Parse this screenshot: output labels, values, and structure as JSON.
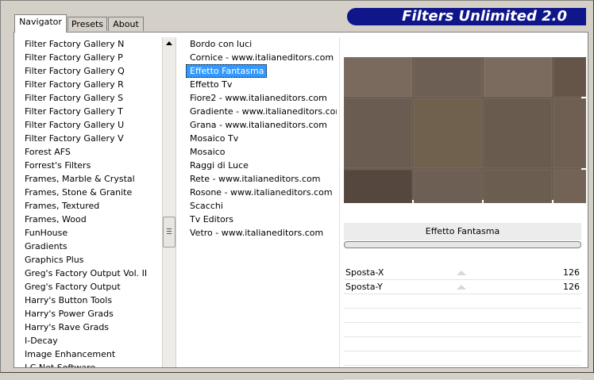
{
  "app": {
    "banner_title": "Filters Unlimited 2.0"
  },
  "tabs": [
    {
      "label": "Navigator",
      "active": true
    },
    {
      "label": "Presets",
      "active": false
    },
    {
      "label": "About",
      "active": false
    }
  ],
  "categories": [
    "Filter Factory Gallery N",
    "Filter Factory Gallery P",
    "Filter Factory Gallery Q",
    "Filter Factory Gallery R",
    "Filter Factory Gallery S",
    "Filter Factory Gallery T",
    "Filter Factory Gallery U",
    "Filter Factory Gallery V",
    "Forest AFS",
    "Forrest's Filters",
    "Frames, Marble & Crystal",
    "Frames, Stone & Granite",
    "Frames, Textured",
    "Frames, Wood",
    "FunHouse",
    "Gradients",
    "Graphics Plus",
    "Greg's Factory Output Vol. II",
    "Greg's Factory Output",
    "Harry's Button Tools",
    "Harry's Power Grads",
    "Harry's Rave Grads",
    "I-Decay",
    "Image Enhancement",
    "I.C.Net Software"
  ],
  "filters": [
    "Bordo con luci",
    "Cornice - www.italianeditors.com",
    "Effetto Fantasma",
    "Effetto Tv",
    "Fiore2 - www.italianeditors.com",
    "Gradiente - www.italianeditors.com",
    "Grana - www.italianeditors.com",
    "Mosaico Tv",
    "Mosaico",
    "Raggi di Luce",
    "Rete - www.italianeditors.com",
    "Rosone - www.italianeditors.com",
    "Scacchi",
    "Tv Editors",
    "Vetro - www.italianeditors.com"
  ],
  "selected_filter_index": 2,
  "selected_filter_name": "Effetto Fantasma",
  "params": [
    {
      "label": "Sposta-X",
      "value": "126",
      "level": 0.494
    },
    {
      "label": "Sposta-Y",
      "value": "126",
      "level": 0.494
    }
  ],
  "empty_param_rows": 6,
  "colors": {
    "banner_bg": "#0f168a",
    "selection": "#3399ff",
    "preview_tiles": [
      "#7a6a5e",
      "#6d5f54",
      "#7b6b5f",
      "#655548",
      "#6b5c51",
      "#70614f",
      "#6a5b4f",
      "#6f5f53",
      "#55473d",
      "#6e5f54",
      "#6c5d51",
      "#726356"
    ]
  },
  "icons": {
    "scroll_up": "arrow-up-icon",
    "scroll_grip": "grip-icon"
  }
}
